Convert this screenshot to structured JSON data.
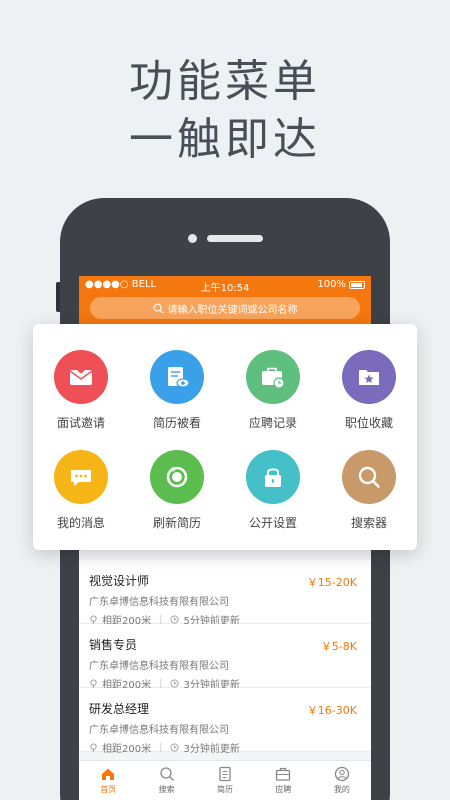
{
  "headline": {
    "line1": "功能菜单",
    "line2": "一触即达"
  },
  "status_bar": {
    "carrier": "●●●●○ BELL",
    "time": "上午10:54",
    "battery": "100%"
  },
  "search": {
    "placeholder": "请输入职位关键词或公司名称"
  },
  "menu": [
    {
      "label": "面试邀请",
      "icon": "envelope-heart-icon",
      "color": "#ef4f57"
    },
    {
      "label": "简历被看",
      "icon": "resume-eye-icon",
      "color": "#3aa0e8"
    },
    {
      "label": "应聘记录",
      "icon": "briefcase-clock-icon",
      "color": "#5fbf7f"
    },
    {
      "label": "职位收藏",
      "icon": "folder-star-icon",
      "color": "#7b6bbd"
    },
    {
      "label": "我的消息",
      "icon": "chat-bubble-icon",
      "color": "#f5b517"
    },
    {
      "label": "刷新简历",
      "icon": "refresh-icon",
      "color": "#5bbd4e"
    },
    {
      "label": "公开设置",
      "icon": "lock-icon",
      "color": "#45c0c8"
    },
    {
      "label": "搜索器",
      "icon": "magnifier-icon",
      "color": "#c89a6a"
    }
  ],
  "jobs": [
    {
      "title": "视觉设计师",
      "salary": "￥15-20K",
      "company": "广东卓博信息科技有限有限公司",
      "distance": "相距200米",
      "updated": "5分钟前更新"
    },
    {
      "title": "销售专员",
      "salary": "￥5-8K",
      "company": "广东卓博信息科技有限有限公司",
      "distance": "相距200米",
      "updated": "3分钟前更新"
    },
    {
      "title": "研发总经理",
      "salary": "￥16-30K",
      "company": "广东卓博信息科技有限有限公司",
      "distance": "相距200米",
      "updated": "3分钟前更新"
    }
  ],
  "tabs": [
    {
      "label": "首页",
      "icon": "home-icon",
      "active": true
    },
    {
      "label": "搜索",
      "icon": "search-icon",
      "active": false
    },
    {
      "label": "简历",
      "icon": "document-icon",
      "active": false
    },
    {
      "label": "应聘",
      "icon": "briefcase-icon",
      "active": false
    },
    {
      "label": "我的",
      "icon": "user-icon",
      "active": false
    }
  ],
  "colors": {
    "accent": "#f5770f",
    "phone_body": "#3e4148",
    "background": "#eef1f3"
  }
}
